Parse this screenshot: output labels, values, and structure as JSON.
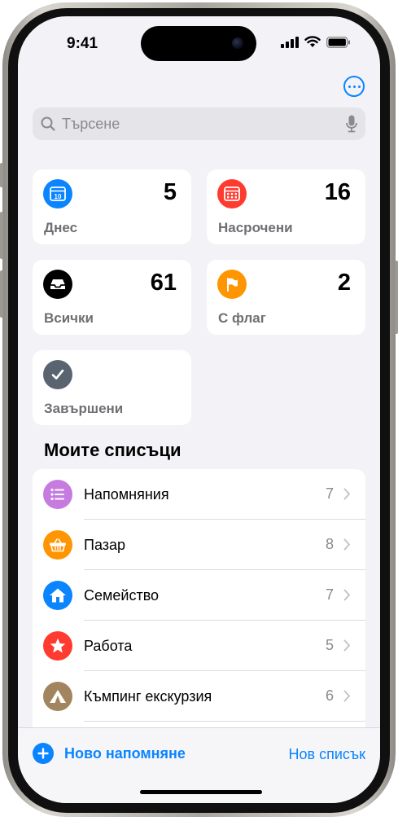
{
  "status": {
    "time": "9:41"
  },
  "search": {
    "placeholder": "Търсене"
  },
  "smart_lists": [
    {
      "label": "Днес",
      "count": "5",
      "icon": "calendar-today-icon",
      "color": "#0a84ff"
    },
    {
      "label": "Насрочени",
      "count": "16",
      "icon": "calendar-grid-icon",
      "color": "#ff3b30"
    },
    {
      "label": "Всички",
      "count": "61",
      "icon": "tray-icon",
      "color": "#000000"
    },
    {
      "label": "С флаг",
      "count": "2",
      "icon": "flag-icon",
      "color": "#ff9500"
    },
    {
      "label": "Завършени",
      "count": "",
      "icon": "checkmark-icon",
      "color": "#5a6470"
    }
  ],
  "today_icon_day": "10",
  "section_title": "Моите списъци",
  "my_lists": [
    {
      "name": "Напомняния",
      "count": "7",
      "icon": "list-bullet-icon",
      "color": "#c57be0"
    },
    {
      "name": "Пазар",
      "count": "8",
      "icon": "basket-icon",
      "color": "#ff9500"
    },
    {
      "name": "Семейство",
      "count": "7",
      "icon": "house-icon",
      "color": "#0a84ff"
    },
    {
      "name": "Работа",
      "count": "5",
      "icon": "star-icon",
      "color": "#ff3b30"
    },
    {
      "name": "Къмпинг екскурзия",
      "count": "6",
      "icon": "tent-icon",
      "color": "#a2845e"
    }
  ],
  "toolbar": {
    "new_reminder": "Ново напомняне",
    "new_list": "Нов списък"
  }
}
